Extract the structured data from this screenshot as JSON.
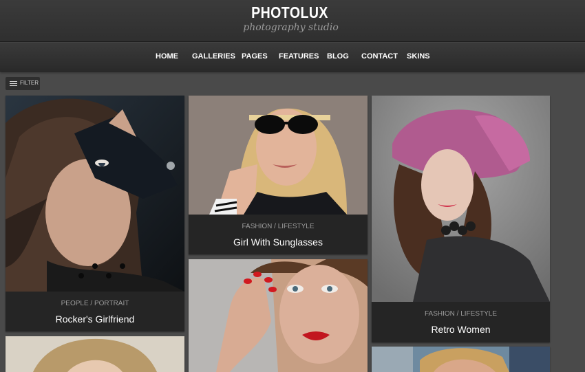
{
  "brand": {
    "title": "PHOTOLUX",
    "tagline": "photography studio"
  },
  "nav": {
    "items": [
      "HOME",
      "GALLERIES",
      "PAGES",
      "FEATURES",
      "BLOG",
      "CONTACT",
      "SKINS"
    ]
  },
  "filter": {
    "label": "FILTER",
    "icon": "menu-lines-icon"
  },
  "gallery": [
    {
      "category": "PEOPLE / PORTRAIT",
      "title": "Rocker's Girlfriend",
      "image": "woman-leather-glove-photo"
    },
    {
      "category": "FASHION / LIFESTYLE",
      "title": "Girl With Sunglasses",
      "image": "woman-sunglasses-photo"
    },
    {
      "category": "FASHION / LIFESTYLE",
      "title": "Retro Women",
      "image": "woman-pink-hat-photo"
    },
    {
      "category": "",
      "title": "",
      "image": "woman-red-lips-photo"
    },
    {
      "category": "",
      "title": "",
      "image": "blonde-woman-photo"
    },
    {
      "category": "",
      "title": "",
      "image": "woman-outdoor-photo"
    }
  ],
  "colors": {
    "background": "#4a4a4a",
    "header": "#333333",
    "card": "#252525"
  }
}
